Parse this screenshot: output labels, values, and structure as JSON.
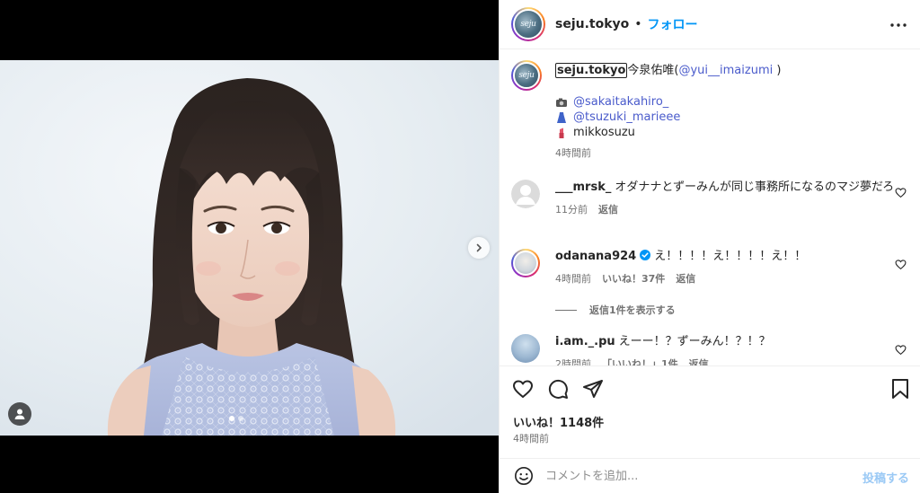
{
  "post": {
    "author": "seju.tokyo",
    "separator": "•",
    "follow_label": "フォロー",
    "avatar_text": "seju"
  },
  "caption": {
    "user": "seju.tokyo",
    "text_prefix": "今泉佑唯(",
    "mention": "@yui__imaizumi",
    "text_suffix": " )",
    "credits": [
      {
        "icon": "camera-icon",
        "text": "@sakaitakahiro_",
        "is_link": true
      },
      {
        "icon": "dress-icon",
        "text": "@tsuzuki_marieee",
        "is_link": true
      },
      {
        "icon": "lipstick-icon",
        "text": "mikkosuzu",
        "is_link": false
      }
    ],
    "time": "4時間前"
  },
  "comments": [
    {
      "user": "___mrsk_",
      "text": "オダナナとずーみんが同じ事務所になるのマジ夢だろ",
      "time": "11分前",
      "likes": "",
      "reply_label": "返信",
      "verified": false
    },
    {
      "user": "odanana924",
      "text": "え！！！！え！！！！え！！",
      "time": "4時間前",
      "likes": "いいね！37件",
      "reply_label": "返信",
      "verified": true
    },
    {
      "user": "i.am._.pu",
      "text": "えーー！？ずーみん！？！？",
      "time": "2時間前",
      "likes": "「いいね！」1件",
      "reply_label": "返信",
      "verified": false
    }
  ],
  "view_replies_label": "返信1件を表示する",
  "engagement": {
    "likes_label": "いいね！1148件",
    "time": "4時間前"
  },
  "composer": {
    "placeholder": "コメントを追加...",
    "post_label": "投稿する"
  },
  "carousel": {
    "count": 2,
    "active_index": 0
  },
  "colors": {
    "accent": "#0095f6",
    "link": "#4a5bcb",
    "post_disabled": "#9ac9f5"
  }
}
